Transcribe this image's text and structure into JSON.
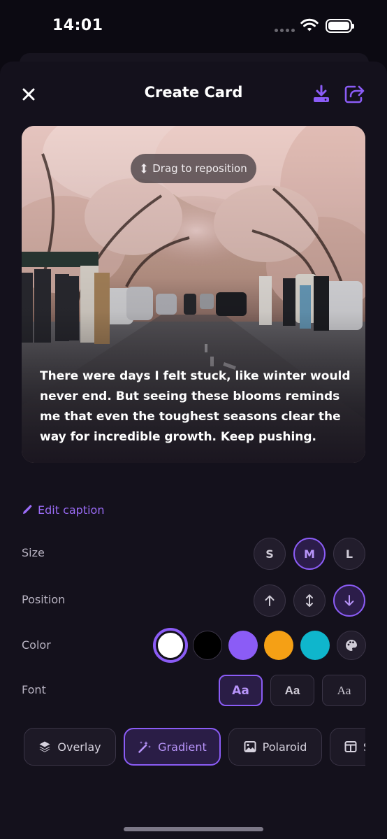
{
  "status_bar": {
    "time": "14:01"
  },
  "header": {
    "title": "Create Card"
  },
  "card": {
    "drag_hint": "Drag to reposition",
    "caption": "There were days I felt stuck, like winter would never end. But seeing these blooms reminds me that even the toughest seasons clear the way for incredible growth. Keep pushing."
  },
  "edit_caption": {
    "label": "Edit caption"
  },
  "size": {
    "label": "Size",
    "options": [
      "S",
      "M",
      "L"
    ],
    "selected": "M"
  },
  "position": {
    "label": "Position",
    "options": [
      "up-arrow-icon",
      "vertical-arrows-icon",
      "down-arrow-icon"
    ],
    "selected": "down-arrow-icon"
  },
  "color": {
    "label": "Color",
    "swatches": [
      "#ffffff",
      "#000000",
      "#8b5cf6",
      "#f5a015",
      "#0fb6cc"
    ],
    "selected": "#ffffff"
  },
  "font": {
    "label": "Font",
    "options": [
      "Aa",
      "Aa",
      "Aa"
    ],
    "selected_index": 0
  },
  "styles": [
    {
      "label": "Overlay",
      "icon": "layers-icon"
    },
    {
      "label": "Gradient",
      "icon": "magic-wand-icon"
    },
    {
      "label": "Polaroid",
      "icon": "image-icon"
    },
    {
      "label": "S",
      "icon": "split-layout-icon"
    }
  ],
  "selected_style": "Gradient",
  "colors": {
    "accent": "#8b5cf6",
    "background": "#14111c"
  }
}
